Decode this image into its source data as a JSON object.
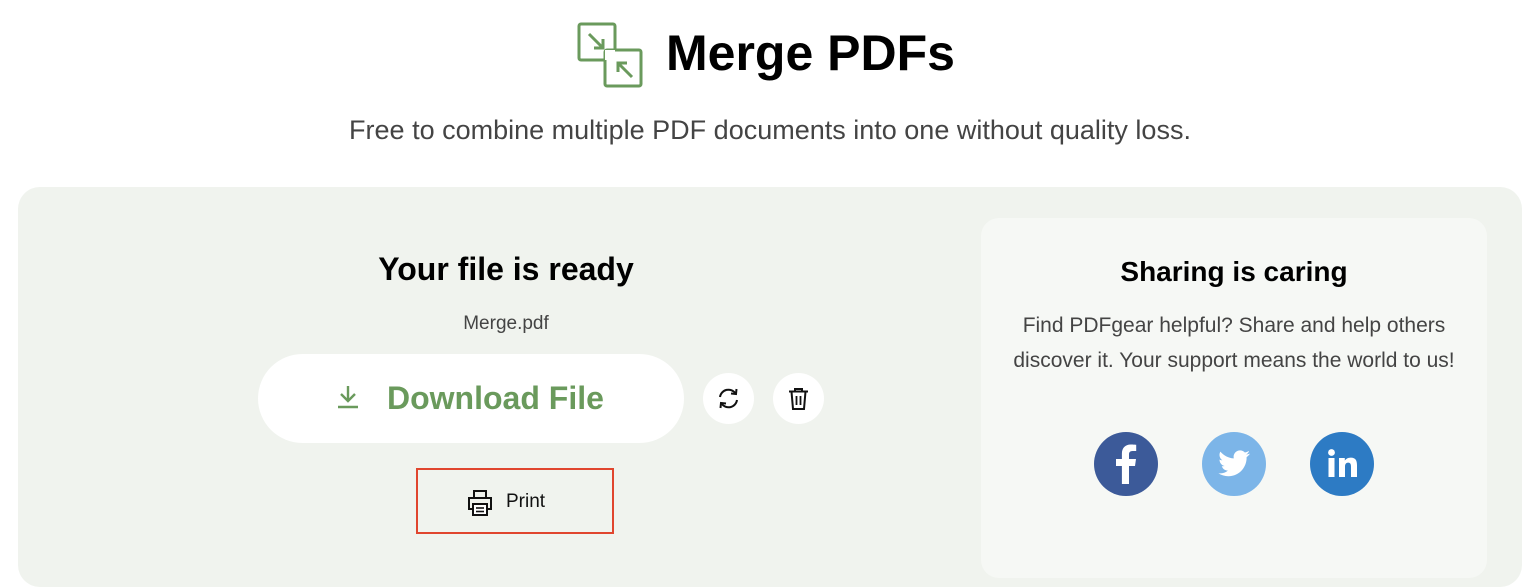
{
  "header": {
    "title": "Merge PDFs",
    "subtitle": "Free to combine multiple PDF documents into one without quality loss.",
    "logo_icon": "merge-arrows-icon"
  },
  "result": {
    "title": "Your file is ready",
    "file_name": "Merge.pdf",
    "download_label": "Download File",
    "download_icon": "download-icon",
    "restart_icon": "refresh-icon",
    "delete_icon": "trash-icon",
    "print_label": "Print",
    "print_icon": "printer-icon"
  },
  "share": {
    "title": "Sharing is caring",
    "text": "Find PDFgear helpful? Share and help others discover it. Your support means the world to us!",
    "networks": [
      {
        "icon": "facebook-icon",
        "color": "#3c5a99"
      },
      {
        "icon": "twitter-icon",
        "color": "#7cb5e8"
      },
      {
        "icon": "linkedin-icon",
        "color": "#2d7bc4"
      }
    ]
  },
  "colors": {
    "accent": "#6a9a5c",
    "panel_bg": "#f0f3ee",
    "highlight_border": "#e0452e"
  }
}
